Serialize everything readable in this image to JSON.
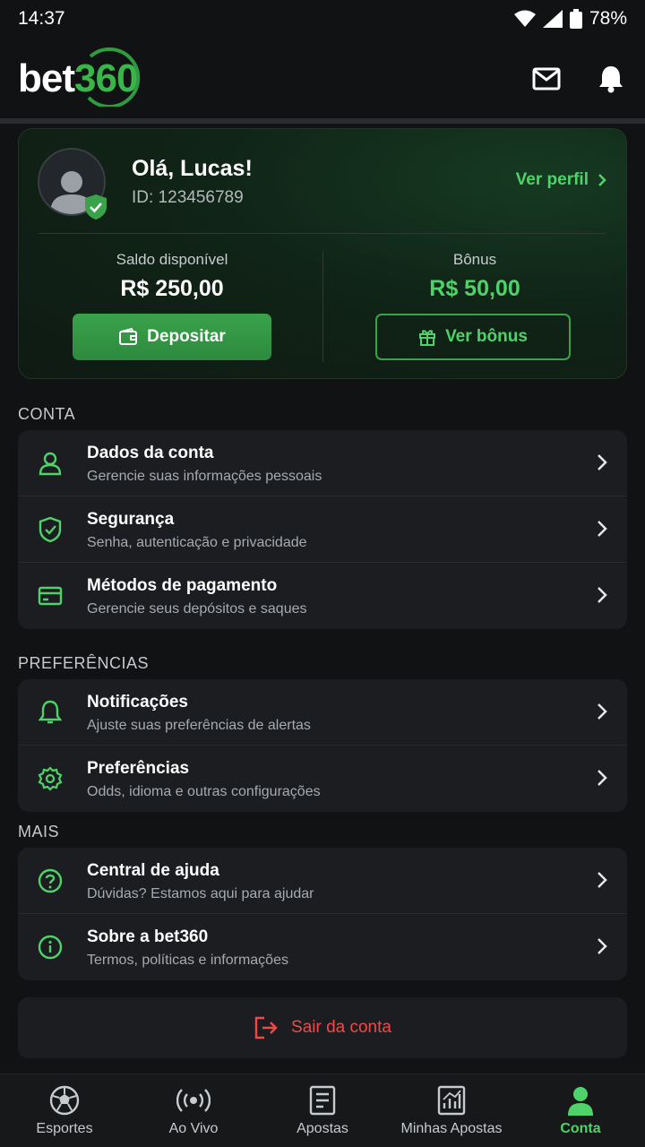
{
  "status_bar": {
    "time": "14:37",
    "battery": "78%"
  },
  "header": {
    "logo_text": "bet",
    "logo_number": "360"
  },
  "profile": {
    "greeting": "Olá, Lucas!",
    "user_id": "ID: 123456789",
    "view_profile_label": "Ver perfil",
    "balance_label": "Saldo disponível",
    "balance_value": "R$ 250,00",
    "bonus_label": "Bônus",
    "bonus_value": "R$ 50,00",
    "deposit_label": "Depositar",
    "view_bonus_label": "Ver bônus"
  },
  "sections": {
    "account": {
      "title": "CONTA",
      "items": [
        {
          "title": "Dados da conta",
          "subtitle": "Gerencie suas informações pessoais",
          "icon": "user-icon"
        },
        {
          "title": "Segurança",
          "subtitle": "Senha, autenticação e privacidade",
          "icon": "shield-check-icon"
        },
        {
          "title": "Métodos de pagamento",
          "subtitle": "Gerencie seus depósitos e saques",
          "icon": "credit-card-icon"
        }
      ]
    },
    "preferences": {
      "title": "PREFERÊNCIAS",
      "items": [
        {
          "title": "Notificações",
          "subtitle": "Ajuste suas preferências de alertas",
          "icon": "bell-icon"
        },
        {
          "title": "Preferências",
          "subtitle": "Odds, idioma e outras configurações",
          "icon": "gear-icon"
        }
      ]
    },
    "more": {
      "title": "MAIS",
      "items": [
        {
          "title": "Central de ajuda",
          "subtitle": "Dúvidas? Estamos aqui para ajudar",
          "icon": "help-circle-icon"
        },
        {
          "title": "Sobre a bet360",
          "subtitle": "Termos, políticas e informações",
          "icon": "info-circle-icon"
        }
      ]
    }
  },
  "logout_label": "Sair da conta",
  "bottom_nav": [
    {
      "label": "Esportes",
      "icon": "soccer-ball-icon",
      "active": false
    },
    {
      "label": "Ao Vivo",
      "icon": "live-broadcast-icon",
      "active": false
    },
    {
      "label": "Apostas",
      "icon": "bet-slip-icon",
      "active": false
    },
    {
      "label": "Minhas Apostas",
      "icon": "chart-icon",
      "active": false
    },
    {
      "label": "Conta",
      "icon": "user-filled-icon",
      "active": true
    }
  ],
  "colors": {
    "accent": "#4fd26a",
    "danger": "#ee4a4a",
    "background": "#111213",
    "surface": "#1b1d20"
  }
}
